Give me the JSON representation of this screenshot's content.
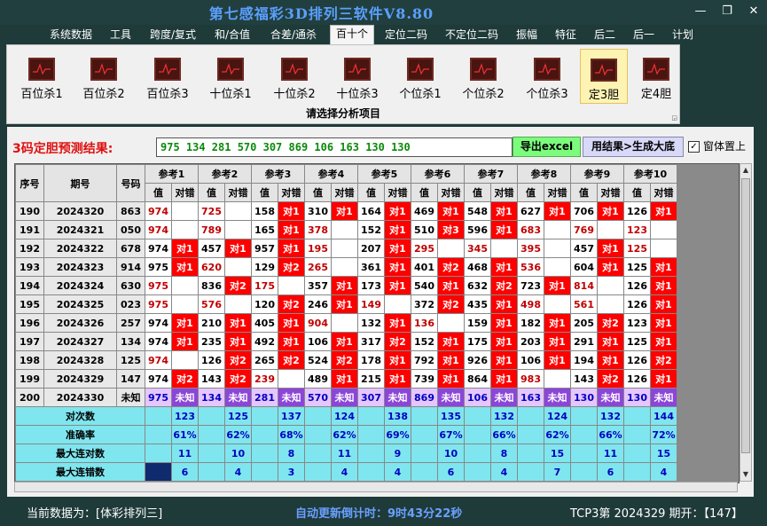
{
  "window": {
    "title": "第七感福彩3D排列三软件V8.80",
    "minimize": "—",
    "restore": "❐",
    "close": "✕"
  },
  "menu": [
    "系统数据",
    "工具",
    "跨度/复式",
    "和/合值",
    "合差/通杀",
    "百十个",
    "定位二码",
    "不定位二码",
    "振幅",
    "特征",
    "后二",
    "后一",
    "计划"
  ],
  "menu_active": "百十个",
  "ribbon": {
    "buttons": [
      "百位杀1",
      "百位杀2",
      "百位杀3",
      "十位杀1",
      "十位杀2",
      "十位杀3",
      "个位杀1",
      "个位杀2",
      "个位杀3",
      "定3胆",
      "定4胆"
    ],
    "active": "定3胆",
    "caption": "请选择分析项目"
  },
  "prediction": {
    "label": "3码定胆预测结果:",
    "value": "975 134 281 570 307 869 106 163 130 130",
    "export_button": "导出excel",
    "generate_button": "用结果>生成大底",
    "ontop_label": "窗体置上",
    "ontop_checked": "✓"
  },
  "table": {
    "headers": {
      "seq": "序号",
      "period": "期号",
      "code": "号码",
      "value": "值",
      "result": "对错",
      "unknown": "未知"
    },
    "refs": [
      "参考1",
      "参考2",
      "参考3",
      "参考4",
      "参考5",
      "参考6",
      "参考7",
      "参考8",
      "参考9",
      "参考10"
    ],
    "rows": [
      {
        "seq": "190",
        "period": "2024320",
        "code": "863",
        "cells": [
          [
            "974",
            "",
            0
          ],
          [
            "725",
            "",
            0
          ],
          [
            "158",
            "对1",
            1
          ],
          [
            "310",
            "对1",
            1
          ],
          [
            "164",
            "对1",
            1
          ],
          [
            "469",
            "对1",
            1
          ],
          [
            "548",
            "对1",
            1
          ],
          [
            "627",
            "对1",
            1
          ],
          [
            "706",
            "对1",
            1
          ],
          [
            "126",
            "对1",
            1
          ]
        ]
      },
      {
        "seq": "191",
        "period": "2024321",
        "code": "050",
        "cells": [
          [
            "974",
            "",
            0
          ],
          [
            "789",
            "",
            0
          ],
          [
            "165",
            "对1",
            1
          ],
          [
            "378",
            "",
            0
          ],
          [
            "152",
            "对1",
            1
          ],
          [
            "510",
            "对3",
            1
          ],
          [
            "596",
            "对1",
            1
          ],
          [
            "683",
            "",
            0
          ],
          [
            "769",
            "",
            0
          ],
          [
            "123",
            "",
            0
          ]
        ]
      },
      {
        "seq": "192",
        "period": "2024322",
        "code": "678",
        "cells": [
          [
            "974",
            "对1",
            1
          ],
          [
            "457",
            "对1",
            1
          ],
          [
            "957",
            "对1",
            1
          ],
          [
            "195",
            "",
            0
          ],
          [
            "207",
            "对1",
            1
          ],
          [
            "295",
            "",
            0
          ],
          [
            "345",
            "",
            0
          ],
          [
            "395",
            "",
            0
          ],
          [
            "457",
            "对1",
            1
          ],
          [
            "125",
            "",
            0
          ]
        ]
      },
      {
        "seq": "193",
        "period": "2024323",
        "code": "914",
        "cells": [
          [
            "975",
            "对1",
            1
          ],
          [
            "620",
            "",
            0
          ],
          [
            "129",
            "对2",
            1
          ],
          [
            "265",
            "",
            0
          ],
          [
            "361",
            "对1",
            1
          ],
          [
            "401",
            "对2",
            1
          ],
          [
            "468",
            "对1",
            1
          ],
          [
            "536",
            "",
            0
          ],
          [
            "604",
            "对1",
            1
          ],
          [
            "125",
            "对1",
            1
          ]
        ]
      },
      {
        "seq": "194",
        "period": "2024324",
        "code": "630",
        "cells": [
          [
            "975",
            "",
            0
          ],
          [
            "836",
            "对2",
            1
          ],
          [
            "175",
            "",
            0
          ],
          [
            "357",
            "对1",
            1
          ],
          [
            "173",
            "对1",
            1
          ],
          [
            "540",
            "对1",
            1
          ],
          [
            "632",
            "对2",
            1
          ],
          [
            "723",
            "对1",
            1
          ],
          [
            "814",
            "",
            0
          ],
          [
            "126",
            "对1",
            1
          ]
        ]
      },
      {
        "seq": "195",
        "period": "2024325",
        "code": "023",
        "cells": [
          [
            "975",
            "",
            0
          ],
          [
            "576",
            "",
            0
          ],
          [
            "120",
            "对2",
            1
          ],
          [
            "246",
            "对1",
            1
          ],
          [
            "149",
            "",
            0
          ],
          [
            "372",
            "对2",
            1
          ],
          [
            "435",
            "对1",
            1
          ],
          [
            "498",
            "",
            0
          ],
          [
            "561",
            "",
            0
          ],
          [
            "126",
            "对1",
            1
          ]
        ]
      },
      {
        "seq": "196",
        "period": "2024326",
        "code": "257",
        "cells": [
          [
            "974",
            "对1",
            1
          ],
          [
            "210",
            "对1",
            1
          ],
          [
            "405",
            "对1",
            1
          ],
          [
            "904",
            "",
            0
          ],
          [
            "132",
            "对1",
            1
          ],
          [
            "136",
            "",
            0
          ],
          [
            "159",
            "对1",
            1
          ],
          [
            "182",
            "对1",
            1
          ],
          [
            "205",
            "对2",
            1
          ],
          [
            "123",
            "对1",
            1
          ]
        ]
      },
      {
        "seq": "197",
        "period": "2024327",
        "code": "134",
        "cells": [
          [
            "974",
            "对1",
            1
          ],
          [
            "235",
            "对1",
            1
          ],
          [
            "492",
            "对1",
            1
          ],
          [
            "106",
            "对1",
            1
          ],
          [
            "317",
            "对2",
            1
          ],
          [
            "152",
            "对1",
            1
          ],
          [
            "175",
            "对1",
            1
          ],
          [
            "203",
            "对1",
            1
          ],
          [
            "291",
            "对1",
            1
          ],
          [
            "125",
            "对1",
            1
          ]
        ]
      },
      {
        "seq": "198",
        "period": "2024328",
        "code": "125",
        "cells": [
          [
            "974",
            "",
            0
          ],
          [
            "126",
            "对2",
            1
          ],
          [
            "265",
            "对2",
            1
          ],
          [
            "524",
            "对2",
            1
          ],
          [
            "178",
            "对1",
            1
          ],
          [
            "792",
            "对1",
            1
          ],
          [
            "926",
            "对1",
            1
          ],
          [
            "106",
            "对1",
            1
          ],
          [
            "194",
            "对1",
            1
          ],
          [
            "126",
            "对2",
            1
          ]
        ]
      },
      {
        "seq": "199",
        "period": "2024329",
        "code": "147",
        "cells": [
          [
            "974",
            "对2",
            1
          ],
          [
            "143",
            "对2",
            1
          ],
          [
            "239",
            "",
            0
          ],
          [
            "489",
            "对1",
            1
          ],
          [
            "215",
            "对1",
            1
          ],
          [
            "739",
            "对1",
            1
          ],
          [
            "864",
            "对1",
            1
          ],
          [
            "983",
            "",
            0
          ],
          [
            "143",
            "对2",
            1
          ],
          [
            "126",
            "对1",
            1
          ]
        ]
      }
    ],
    "last_row": {
      "seq": "200",
      "period": "2024330",
      "code": "未知",
      "values": [
        "975",
        "134",
        "281",
        "570",
        "307",
        "869",
        "106",
        "163",
        "130",
        "130"
      ]
    },
    "stats": [
      {
        "label": "对次数",
        "values": [
          "123",
          "125",
          "137",
          "124",
          "138",
          "135",
          "132",
          "124",
          "132",
          "144"
        ]
      },
      {
        "label": "准确率",
        "values": [
          "61%",
          "62%",
          "68%",
          "62%",
          "69%",
          "67%",
          "66%",
          "62%",
          "66%",
          "72%"
        ]
      },
      {
        "label": "最大连对数",
        "values": [
          "11",
          "10",
          "8",
          "11",
          "9",
          "10",
          "8",
          "15",
          "11",
          "15"
        ]
      },
      {
        "label": "最大连错数",
        "values": [
          "6",
          "4",
          "3",
          "4",
          "4",
          "6",
          "4",
          "7",
          "6",
          "4"
        ]
      }
    ]
  },
  "status": {
    "current": "当前数据为：[体彩排列三]",
    "countdown_label": "自动更新倒计时：",
    "countdown_value": "9时43分22秒",
    "draw": "TCP3第 2024329 期开：【147】"
  },
  "colors": {
    "hit": "#ff0000",
    "stat_bg": "#7fe6ef",
    "pred_bg": "#e6c6ff",
    "unknown_bg": "#8b46d8",
    "title": "#5aa0ff"
  }
}
